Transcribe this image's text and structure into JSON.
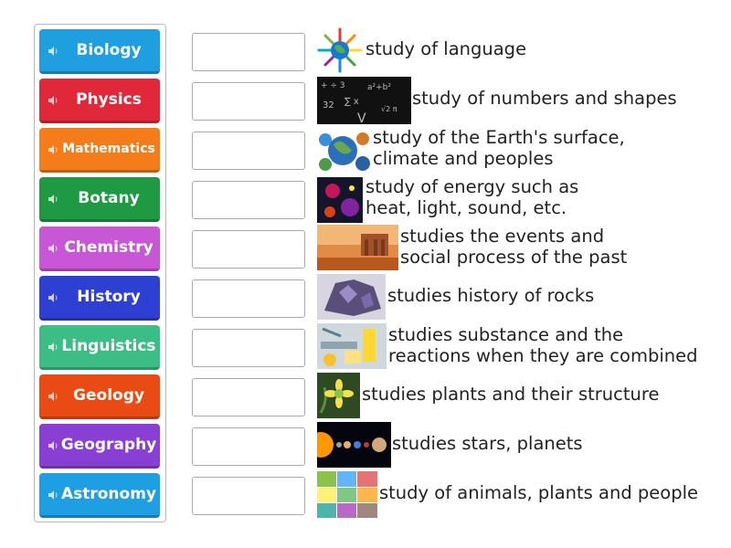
{
  "tiles": [
    {
      "label": "Biology",
      "color": "#1f9ee0"
    },
    {
      "label": "Physics",
      "color": "#e0283a"
    },
    {
      "label": "Mathematics",
      "color": "#f47c1a"
    },
    {
      "label": "Botany",
      "color": "#1f9a43"
    },
    {
      "label": "Chemistry",
      "color": "#c857d6"
    },
    {
      "label": "History",
      "color": "#2e40d2"
    },
    {
      "label": "Linguistics",
      "color": "#3dbd86"
    },
    {
      "label": "Geology",
      "color": "#ea4a14"
    },
    {
      "label": "Geography",
      "color": "#8a3fd4"
    },
    {
      "label": "Astronomy",
      "color": "#1e9fe4"
    }
  ],
  "rows": [
    {
      "line1": "study of language",
      "line2": "",
      "image": "colorful-globe-image"
    },
    {
      "line1": "study of numbers and shapes",
      "line2": "",
      "image": "math-formulas-image"
    },
    {
      "line1": "study of the Earth's surface,",
      "line2": "climate and peoples",
      "image": "globes-collage-image"
    },
    {
      "line1": "study of energy such as",
      "line2": "heat, light, sound, etc.",
      "image": "energy-image"
    },
    {
      "line1": "studies the events and",
      "line2": "social process of the past",
      "image": "ancient-ruins-image"
    },
    {
      "line1": "studies history of rocks",
      "line2": "",
      "image": "crystal-rock-image"
    },
    {
      "line1": "studies substance and the",
      "line2": "reactions when they are combined",
      "image": "lab-equipment-image"
    },
    {
      "line1": "studies plants and their structure",
      "line2": "",
      "image": "flower-image"
    },
    {
      "line1": "studies stars, planets",
      "line2": "",
      "image": "solar-system-image"
    },
    {
      "line1": "study of animals, plants and people",
      "line2": "",
      "image": "life-collage-image"
    }
  ]
}
